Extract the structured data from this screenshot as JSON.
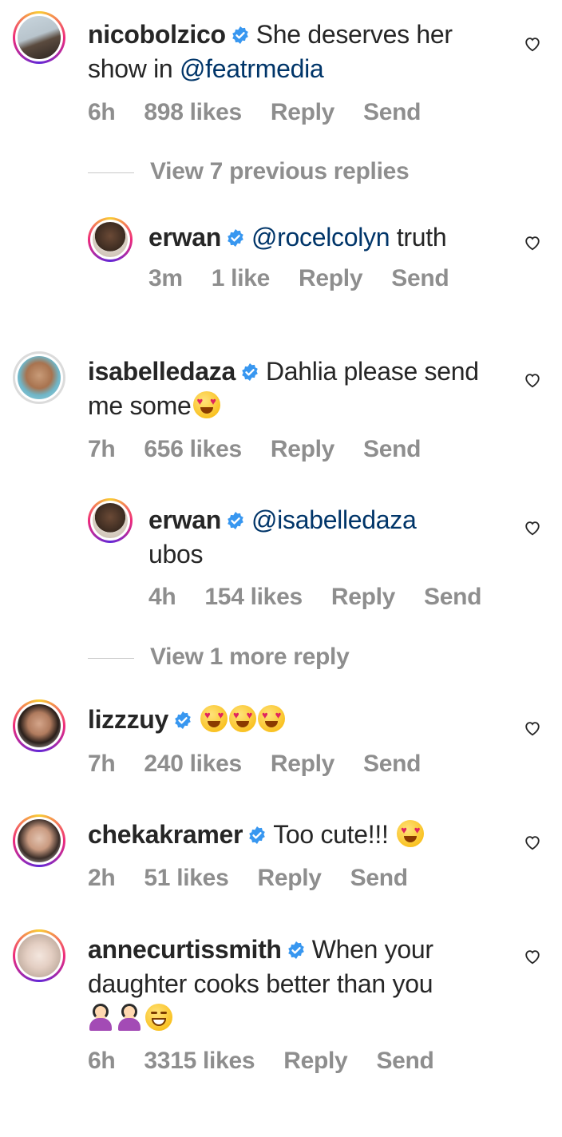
{
  "comments": [
    {
      "username": "nicobolzico",
      "text": "She deserves her show in ",
      "mention": "@featrmedia",
      "time": "6h",
      "likes": "898 likes",
      "reply": "Reply",
      "send": "Send"
    },
    {
      "view_replies": "View 7 previous replies"
    },
    {
      "username": "erwan",
      "mention": "@rocelcolyn",
      "text": " truth",
      "time": "3m",
      "likes": "1 like",
      "reply": "Reply",
      "send": "Send"
    },
    {
      "username": "isabelledaza",
      "text": "Dahlia please send me some",
      "time": "7h",
      "likes": "656 likes",
      "reply": "Reply",
      "send": "Send"
    },
    {
      "username": "erwan",
      "mention": "@isabelledaza",
      "text": "ubos",
      "time": "4h",
      "likes": "154 likes",
      "reply": "Reply",
      "send": "Send"
    },
    {
      "view_replies": "View 1 more reply"
    },
    {
      "username": "lizzzuy",
      "time": "7h",
      "likes": "240 likes",
      "reply": "Reply",
      "send": "Send"
    },
    {
      "username": "chekakramer",
      "text": "Too cute!!!",
      "time": "2h",
      "likes": "51 likes",
      "reply": "Reply",
      "send": "Send"
    },
    {
      "username": "annecurtissmith",
      "text": "When your daughter cooks better than you",
      "time": "6h",
      "likes": "3315 likes",
      "reply": "Reply",
      "send": "Send"
    }
  ],
  "colors": {
    "verified": "#3897f0",
    "mention": "#003569",
    "meta": "#8e8e8e"
  },
  "icons": {
    "heart": "heart-outline-icon",
    "verified": "verified-badge-icon"
  }
}
